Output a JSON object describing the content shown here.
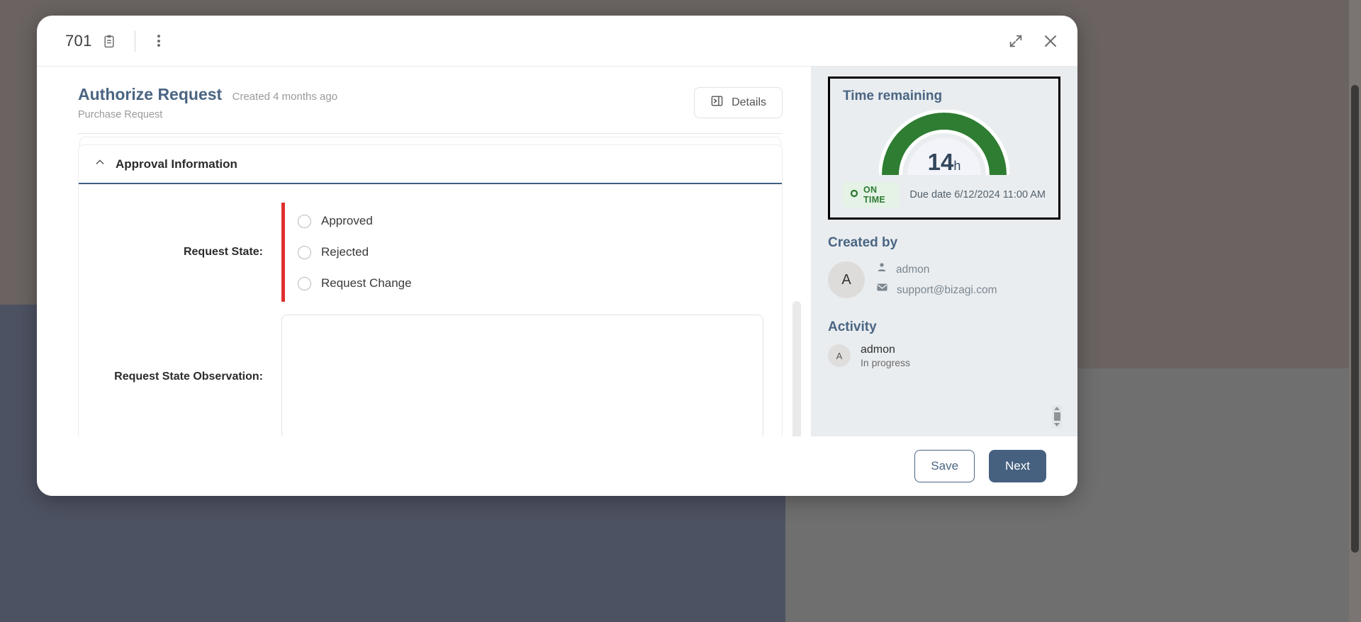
{
  "titlebar": {
    "case_id": "701",
    "clipboard_icon": "clipboard-icon",
    "kebab_icon": "more-vertical-icon",
    "expand_icon": "expand-icon",
    "close_icon": "close-icon"
  },
  "heading": {
    "title": "Authorize Request",
    "created_ago": "Created 4 months ago",
    "subtitle": "Purchase Request",
    "details_label": "Details",
    "details_icon": "panel-right-icon"
  },
  "form": {
    "section_title": "Approval Information",
    "collapse_icon": "chevron-up-icon",
    "fields": [
      {
        "label": "Request State:",
        "type": "radio",
        "required": true,
        "selected": null,
        "options": [
          "Approved",
          "Rejected",
          "Request Change"
        ]
      },
      {
        "label": "Request State Observation:",
        "type": "textarea",
        "value": "",
        "placeholder": ""
      }
    ]
  },
  "side_panel": {
    "time": {
      "heading": "Time remaining",
      "gauge_value": "14",
      "gauge_unit": "h",
      "gauge_color": "#2e7d32",
      "gauge_percent": 100,
      "status_label": "ON TIME",
      "status_icon": "circle-icon",
      "status_color": "#2d7a33",
      "due_date": "Due date 6/12/2024 11:00 AM"
    },
    "created_by": {
      "heading": "Created by",
      "avatar_initial": "A",
      "user_icon": "user-icon",
      "user_name": "admon",
      "mail_icon": "mail-icon",
      "email": "support@bizagi.com"
    },
    "activity": {
      "heading": "Activity",
      "avatar_initial": "A",
      "user_name": "admon",
      "status": "In progress"
    }
  },
  "footer": {
    "save_label": "Save",
    "next_label": "Next"
  }
}
